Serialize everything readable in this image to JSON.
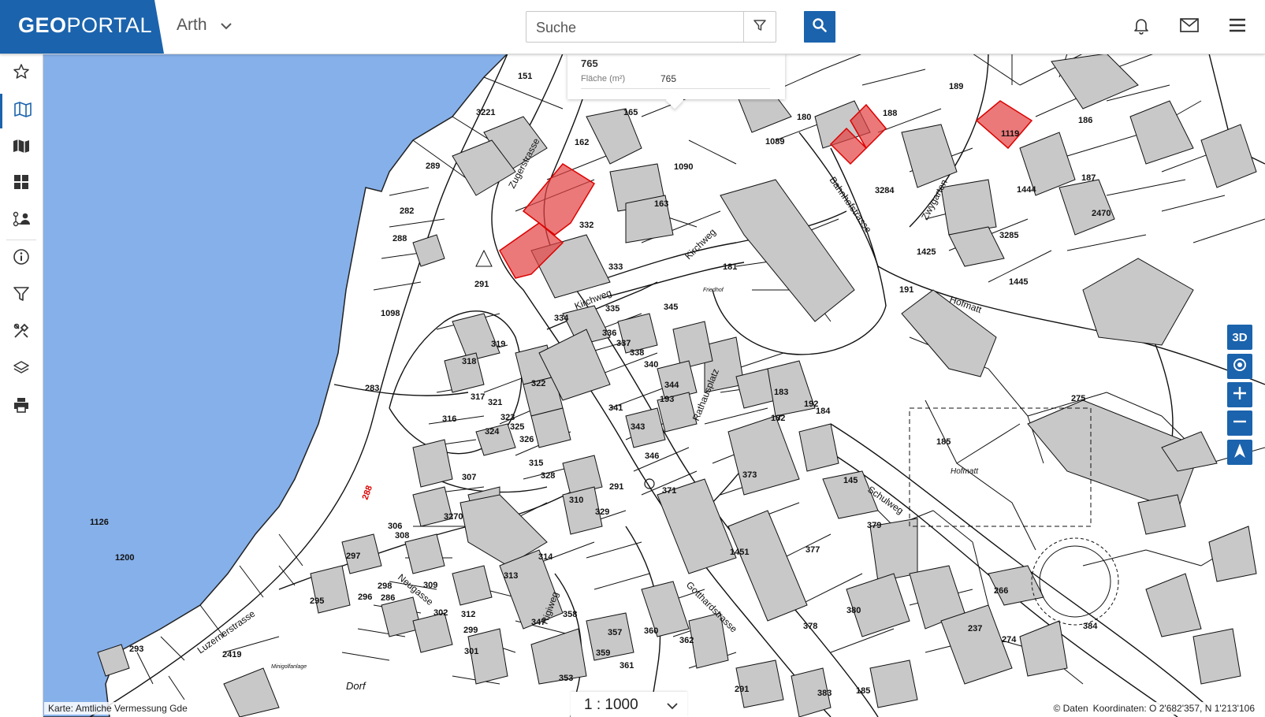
{
  "header": {
    "logo_part1": "GEO",
    "logo_part2": "PORTAL",
    "municipality": "Arth",
    "search_placeholder": "Suche"
  },
  "popup": {
    "parcel_id": "765",
    "area_label": "Fläche (m²)",
    "area_value": "765"
  },
  "map": {
    "parcel_labels": [
      "151",
      "165",
      "180",
      "189",
      "186",
      "188",
      "1119",
      "3221",
      "289",
      "162",
      "1090",
      "1089",
      "282",
      "288",
      "291",
      "332",
      "163",
      "333",
      "181",
      "3284",
      "1425",
      "1445",
      "3285",
      "1444",
      "187",
      "2470",
      "191",
      "1098",
      "335",
      "334",
      "345",
      "336",
      "337",
      "338",
      "340",
      "319",
      "318",
      "317",
      "321",
      "283",
      "316",
      "322",
      "323",
      "324",
      "325",
      "326",
      "344",
      "193",
      "341",
      "343",
      "183",
      "192",
      "184",
      "182",
      "185",
      "275",
      "315",
      "328",
      "307",
      "291",
      "346",
      "371",
      "373",
      "145",
      "3270",
      "310",
      "329",
      "306",
      "308",
      "1126",
      "1200",
      "297",
      "298",
      "295",
      "296",
      "286",
      "309",
      "313",
      "314",
      "302",
      "312",
      "299",
      "301",
      "347",
      "358",
      "360",
      "362",
      "357",
      "359",
      "361",
      "353",
      "1451",
      "377",
      "379",
      "380",
      "378",
      "384",
      "237",
      "274",
      "266",
      "293",
      "2419",
      "291",
      "383",
      "185"
    ],
    "red_labels": [
      "288"
    ],
    "streets": {
      "zugerstrasse": "Zugerstrasse",
      "kirchweg": "Kirchweg",
      "bahnhofstrasse": "Bahnhofstrasse",
      "zwygarten": "Zwygarten",
      "hofmatt": "Hofmatt",
      "rathausplatz": "Rathausplatz",
      "schulweg": "Schulweg",
      "gotthardstrasse": "Gotthardstrasse",
      "luzernerstrasse": "Luzernerstrasse",
      "neugasse": "Neugasse",
      "rigiweg": "Rigiweg",
      "dorf": "Dorf",
      "hofmatt_area": "Hofmatt",
      "friedhof": "Friedhof",
      "minigolf": "Minigolfanlage"
    },
    "water_color": "#86b0ea",
    "highlight_color": "#e34040"
  },
  "controls": {
    "three_d": "3D"
  },
  "footer": {
    "attribution": "Karte: Amtliche Vermessung Gde",
    "scale": "1 : 1000",
    "data_link": "© Daten",
    "coordinates": "Koordinaten: O 2'682'357, N 1'213'106"
  }
}
